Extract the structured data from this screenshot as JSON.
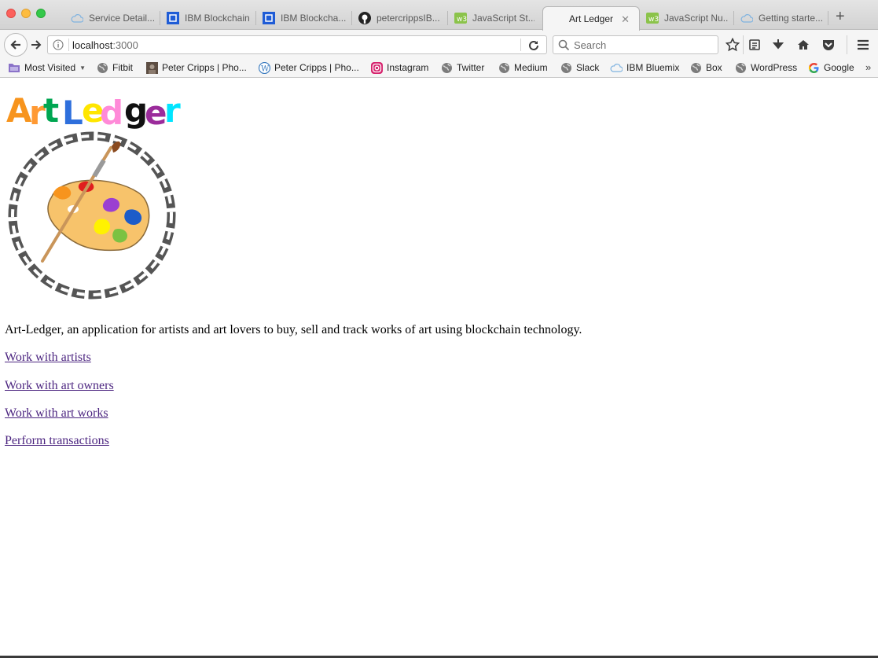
{
  "window": {
    "tabs": [
      {
        "title": "Service Detail...",
        "icon": "cloud-icon"
      },
      {
        "title": "IBM Blockchain",
        "icon": "ibm-blockchain-icon"
      },
      {
        "title": "IBM Blockcha...",
        "icon": "ibm-blockchain-icon"
      },
      {
        "title": "petercrippsIB...",
        "icon": "github-icon"
      },
      {
        "title": "JavaScript St...",
        "icon": "w3schools-icon"
      },
      {
        "title": "Art Ledger",
        "icon": "none",
        "active": true
      },
      {
        "title": "JavaScript Nu...",
        "icon": "w3schools-icon"
      },
      {
        "title": "Getting starte...",
        "icon": "cloud-icon"
      }
    ],
    "new_tab_label": "+",
    "close_tab_label": "✕"
  },
  "navbar": {
    "url_host": "localhost",
    "url_port": ":3000",
    "search_placeholder": "Search"
  },
  "bookmarks": {
    "items": [
      {
        "label": "Most Visited",
        "icon": "folder-icon"
      },
      {
        "label": "Fitbit",
        "icon": "globe-icon"
      },
      {
        "label": "Peter Cripps | Pho...",
        "icon": "photo-icon"
      },
      {
        "label": "Peter Cripps | Pho...",
        "icon": "wordpress-icon"
      },
      {
        "label": "Instagram",
        "icon": "instagram-icon"
      },
      {
        "label": "Twitter",
        "icon": "globe-icon"
      },
      {
        "label": "Medium",
        "icon": "globe-icon"
      },
      {
        "label": "Slack",
        "icon": "globe-icon"
      },
      {
        "label": "IBM Bluemix",
        "icon": "cloud-icon"
      },
      {
        "label": "Box",
        "icon": "globe-icon"
      },
      {
        "label": "WordPress",
        "icon": "globe-icon"
      },
      {
        "label": "Google",
        "icon": "google-icon"
      }
    ],
    "more": "»"
  },
  "page": {
    "logo": {
      "letters": [
        "A",
        "r",
        "t",
        "L",
        "e",
        "d",
        "g",
        "e",
        "r"
      ],
      "letter_colors": [
        "#f7941d",
        "#ff9933",
        "#00a651",
        "#2e6fdc",
        "#ffe600",
        "#ff8ad8",
        "#111111",
        "#9b2c9b",
        "#00e5ff"
      ]
    },
    "description": "Art-Ledger, an application for artists and art lovers to buy, sell and track works of art using blockchain technology.",
    "links": [
      "Work with artists",
      "Work with art owners",
      "Work with art works",
      "Perform transactions"
    ],
    "link_color": "#4c2580"
  }
}
